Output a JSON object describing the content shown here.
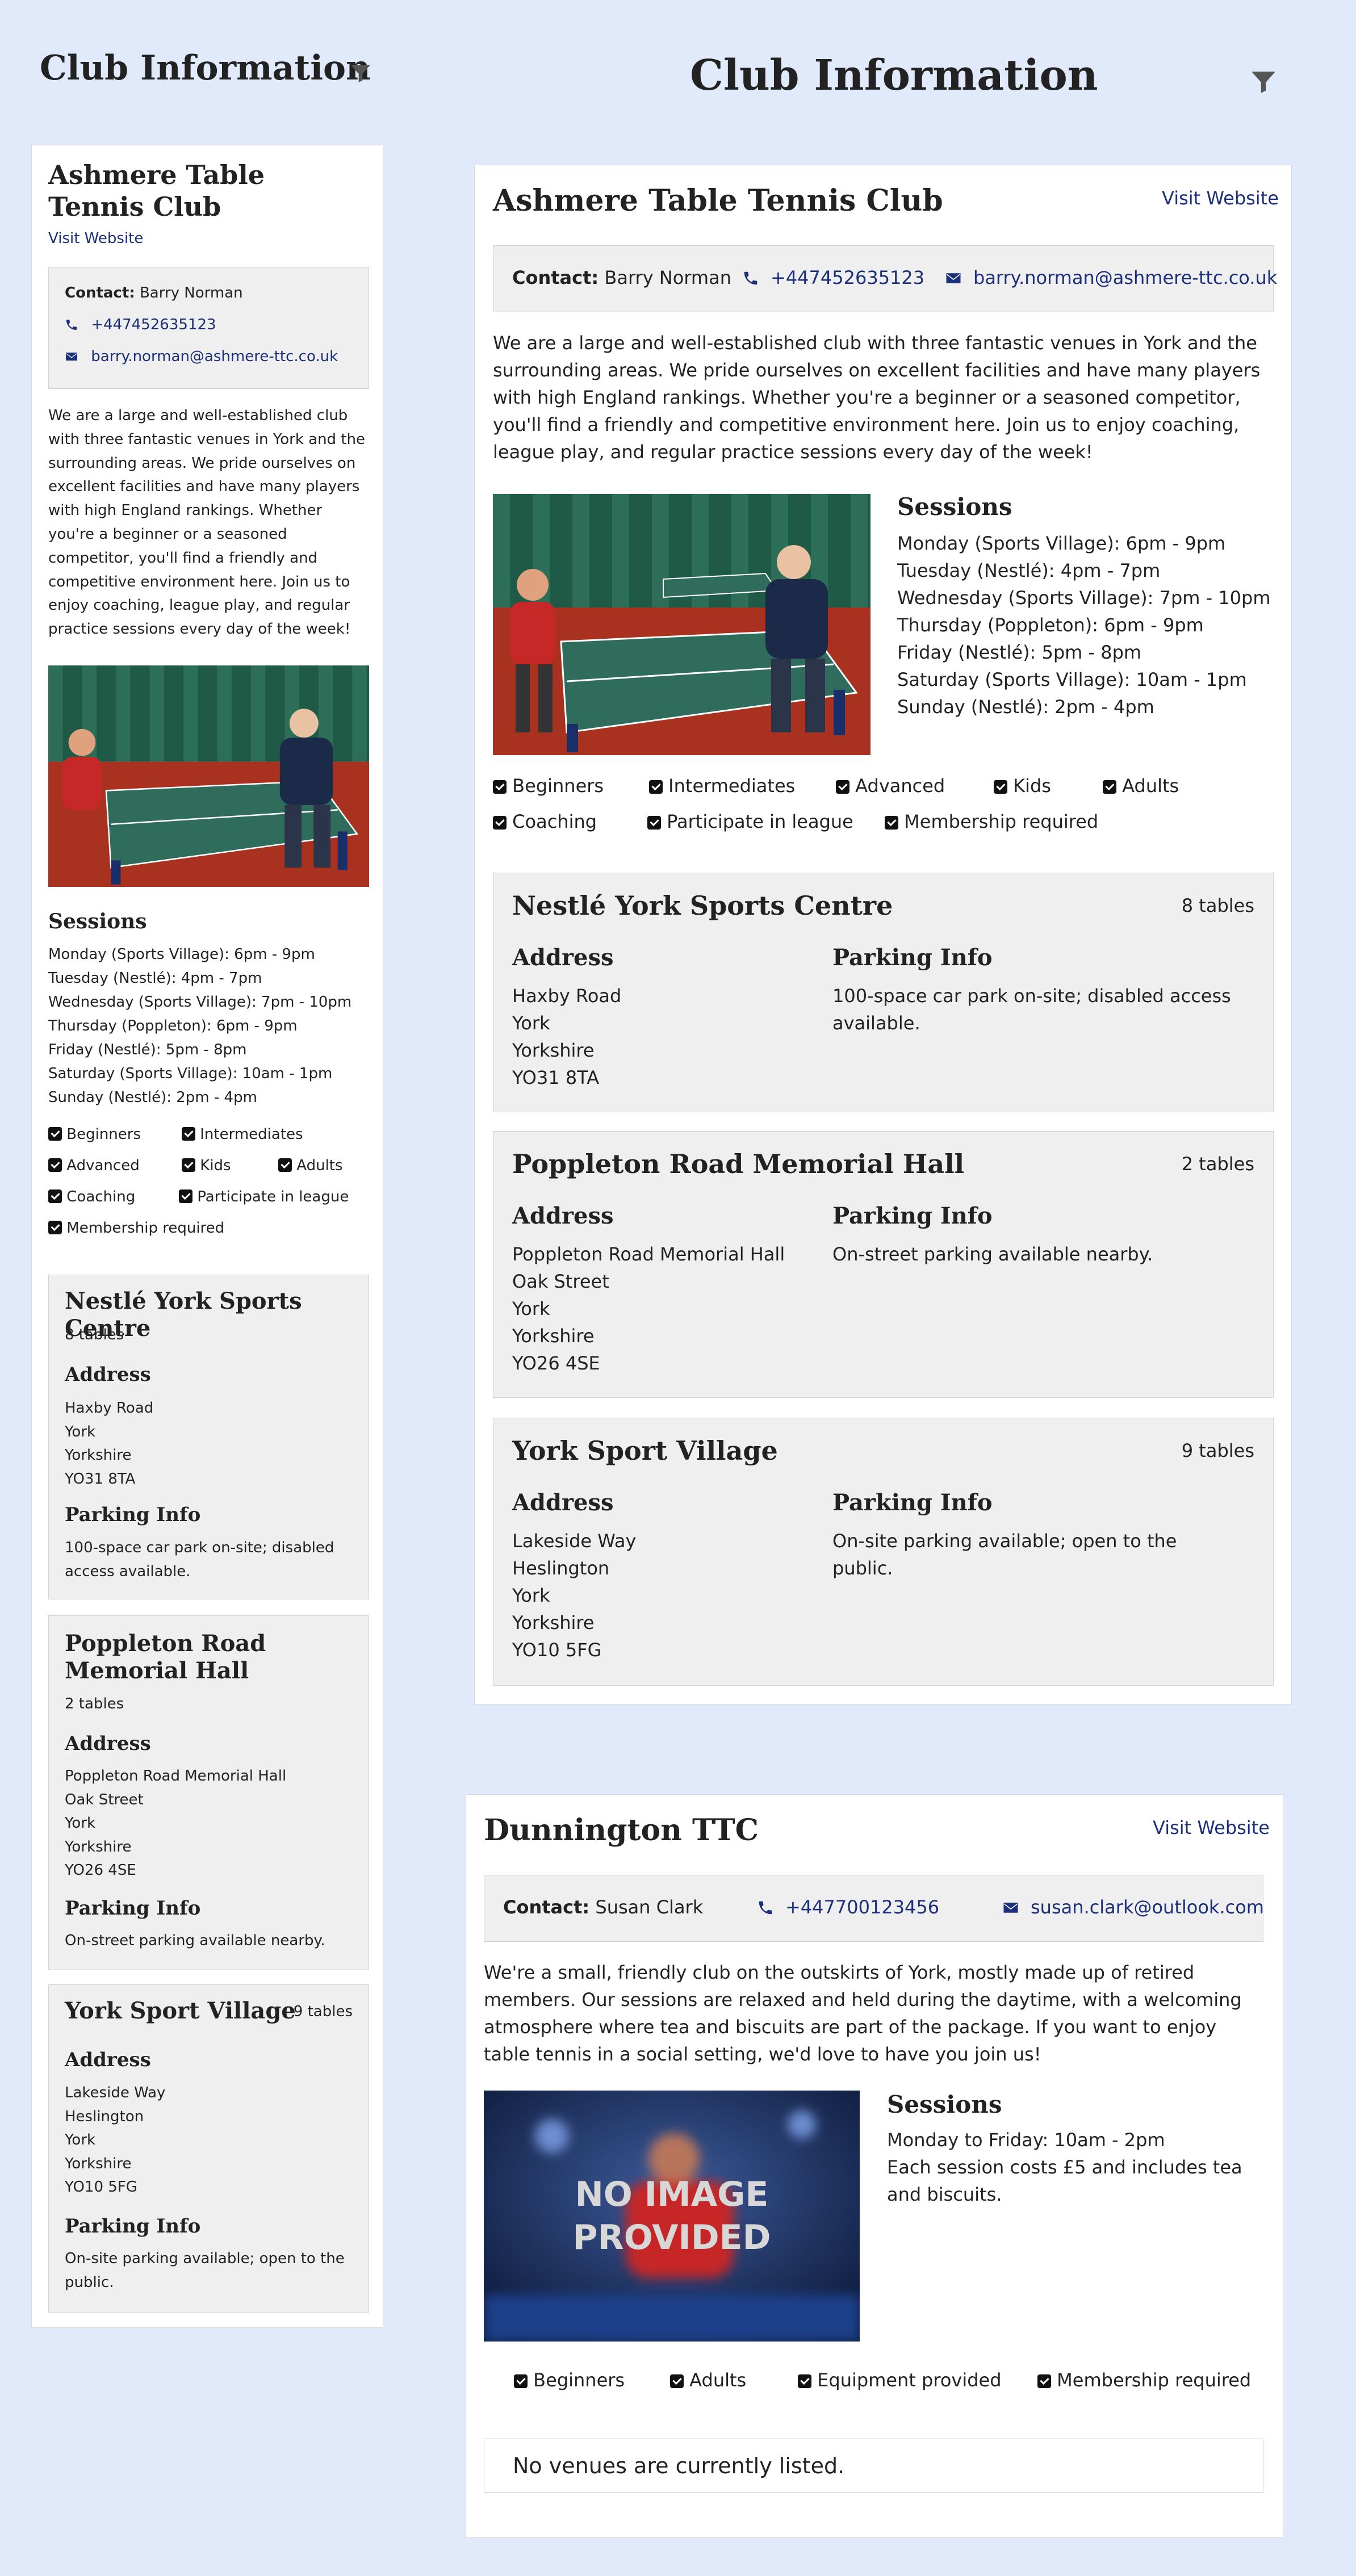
{
  "page": {
    "title": "Club Information"
  },
  "clubs": [
    {
      "name": "Ashmere Table Tennis Club",
      "visit_label": "Visit Website",
      "contact_label": "Contact:",
      "contact_name": "Barry Norman",
      "phone": "+447452635123",
      "email": "barry.norman@ashmere-ttc.co.uk",
      "description": "We are a large and well-established club with three fantastic venues in York and the surrounding areas. We pride ourselves on excellent facilities and have many players with high England rankings. Whether you're a beginner or a seasoned competitor, you'll find a friendly and competitive environment here. Join us to enjoy coaching, league play, and regular practice sessions every day of the week!",
      "sessions_heading": "Sessions",
      "sessions": [
        "Monday (Sports Village): 6pm - 9pm",
        "Tuesday (Nestlé): 4pm - 7pm",
        "Wednesday (Sports Village): 7pm - 10pm",
        "Thursday (Poppleton): 6pm - 9pm",
        "Friday (Nestlé): 5pm - 8pm",
        "Saturday (Sports Village): 10am - 1pm",
        "Sunday (Nestlé): 2pm - 4pm"
      ],
      "tags": [
        "Beginners",
        "Intermediates",
        "Advanced",
        "Kids",
        "Adults",
        "Coaching",
        "Participate in league",
        "Membership required"
      ],
      "venues": [
        {
          "name": "Nestlé York Sports Centre",
          "tables": "8 tables",
          "address_heading": "Address",
          "address": [
            "Haxby Road",
            "York",
            "Yorkshire",
            "YO31 8TA"
          ],
          "parking_heading": "Parking Info",
          "parking": "100-space car park on-site; disabled access available."
        },
        {
          "name": "Poppleton Road Memorial Hall",
          "tables": "2 tables",
          "address_heading": "Address",
          "address": [
            "Poppleton Road Memorial Hall",
            "Oak Street",
            "York",
            "Yorkshire",
            "YO26 4SE"
          ],
          "parking_heading": "Parking Info",
          "parking": "On-street parking available nearby."
        },
        {
          "name": "York Sport Village",
          "tables": "9 tables",
          "address_heading": "Address",
          "address": [
            "Lakeside Way",
            "Heslington",
            "York",
            "Yorkshire",
            "YO10 5FG"
          ],
          "parking_heading": "Parking Info",
          "parking": "On-site parking available; open to the public."
        }
      ]
    },
    {
      "name": "Dunnington TTC",
      "visit_label": "Visit Website",
      "contact_label": "Contact:",
      "contact_name": "Susan Clark",
      "phone": "+447700123456",
      "email": "susan.clark@outlook.com",
      "description": "We're a small, friendly club on the outskirts of York, mostly made up of retired members. Our sessions are relaxed and held during the daytime, with a welcoming atmosphere where tea and biscuits are part of the package. If you want to enjoy table tennis in a social setting, we'd love to have you join us!",
      "sessions_heading": "Sessions",
      "sessions": [
        "Monday to Friday: 10am - 2pm",
        "Each session costs £5 and includes tea and biscuits."
      ],
      "image_placeholder": "NO IMAGE PROVIDED",
      "tags": [
        "Beginners",
        "Adults",
        "Equipment provided",
        "Membership required"
      ],
      "no_venues": "No venues are currently listed."
    }
  ],
  "icons": {
    "filter": "filter-icon",
    "phone": "phone-icon",
    "email": "envelope-icon",
    "check": "checkbox-checked-icon"
  },
  "colors": {
    "background": "#e0eafa",
    "link": "#1c2f7a",
    "panel": "#efefef"
  }
}
